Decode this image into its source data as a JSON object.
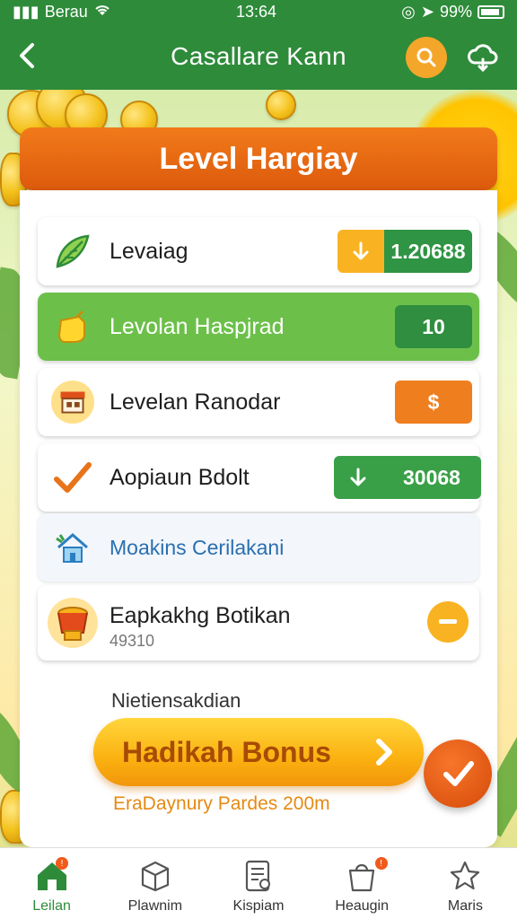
{
  "status_bar": {
    "carrier": "Berau",
    "time": "13:64",
    "battery": "99%"
  },
  "header": {
    "title": "Casallare Kann"
  },
  "banner": {
    "title": "Level Hargiay"
  },
  "rows": [
    {
      "label": "Levaiag",
      "value": "1.20688",
      "icon": "leaf-icon"
    },
    {
      "label": "Levolan Haspjrad",
      "value": "10",
      "icon": "hand-icon"
    },
    {
      "label": "Levelan Ranodar",
      "value": "$",
      "icon": "shop-icon"
    },
    {
      "label": "Aopiaun Bdolt",
      "value": "30068",
      "icon": "check-icon"
    },
    {
      "label": "Moakins Cerilakani",
      "icon": "house-icon"
    },
    {
      "label": "Eapkakhg Botikan",
      "sublabel": "49310",
      "icon": "cup-icon"
    }
  ],
  "note": "Nietiensakdian",
  "bonus": {
    "label": "Hadikah Bonus"
  },
  "footer": "EraDaynury Pardes 200m",
  "nav": [
    {
      "label": "Leilan",
      "icon": "home-icon",
      "active": true,
      "badge": "!"
    },
    {
      "label": "Plawnim",
      "icon": "box-icon"
    },
    {
      "label": "Kispiam",
      "icon": "document-icon"
    },
    {
      "label": "Heaugin",
      "icon": "bag-icon",
      "badge": "!"
    },
    {
      "label": "Maris",
      "icon": "star-icon"
    }
  ],
  "colors": {
    "primary": "#2e8b3a",
    "accent": "#f27a1a",
    "gold": "#fbb110"
  }
}
